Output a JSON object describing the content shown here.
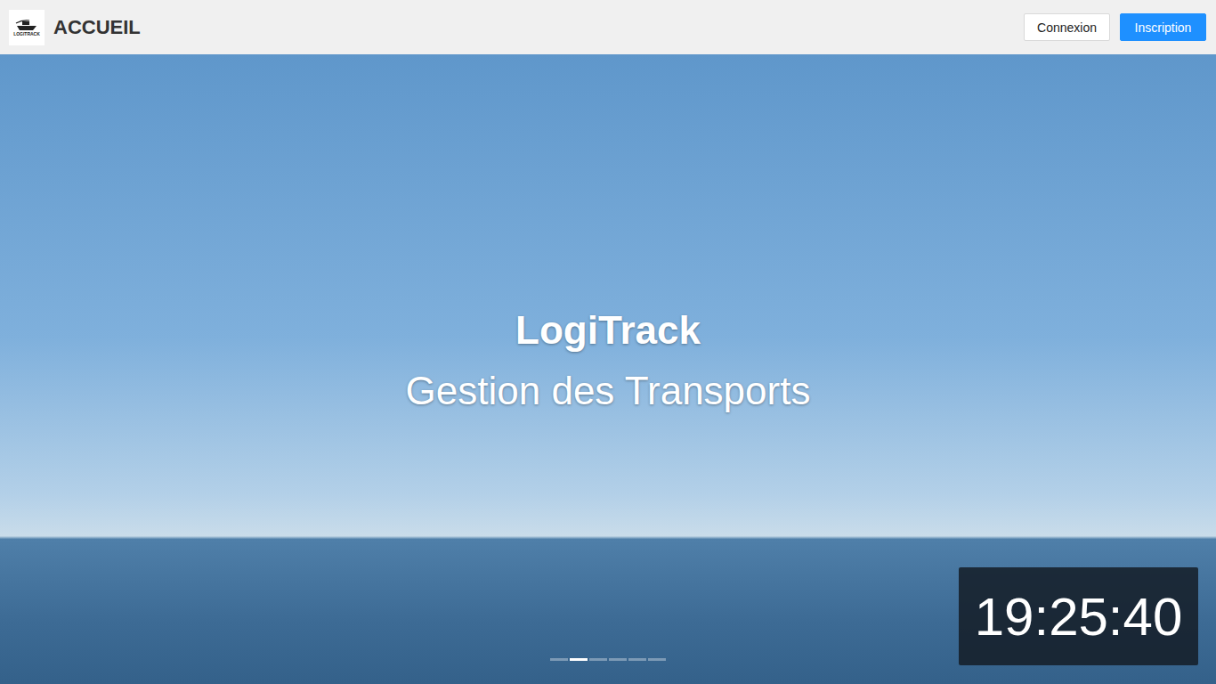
{
  "header": {
    "logo_text": "LOGITRACK",
    "title": "ACCUEIL",
    "buttons": [
      {
        "label": "Connexion",
        "kind": "outline"
      },
      {
        "label": "Inscription",
        "kind": "primary"
      }
    ]
  },
  "hero": {
    "title": "LogiTrack",
    "subtitle": "Gestion des Transports",
    "slides": [
      {
        "selected": false
      },
      {
        "selected": true
      },
      {
        "selected": false
      },
      {
        "selected": false
      },
      {
        "selected": false
      },
      {
        "selected": false
      }
    ]
  },
  "clock": {
    "time": "19:25:40"
  }
}
